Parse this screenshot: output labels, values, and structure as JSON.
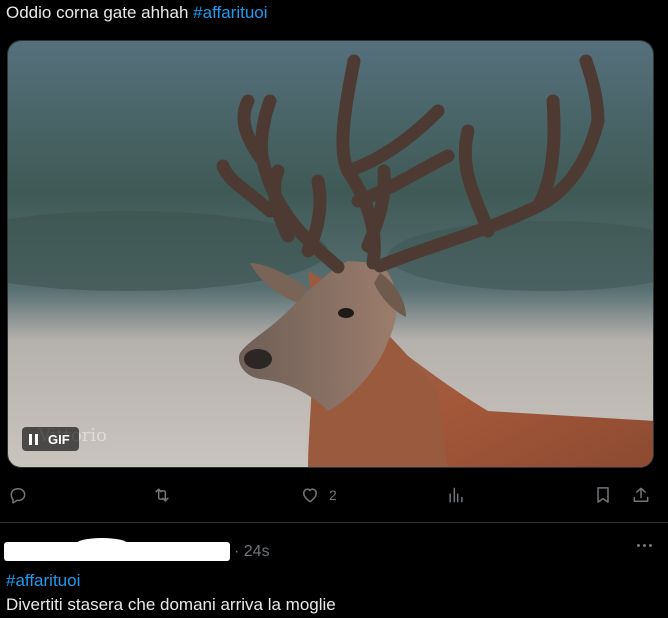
{
  "post": {
    "text": "Oddio corna gate ahhah ",
    "hashtag": "#affarituoi",
    "media_badge": "GIF",
    "media_watermark": "Vittorio"
  },
  "actions": {
    "reply_icon": "reply-icon",
    "repost_icon": "repost-icon",
    "like_icon": "heart-icon",
    "like_count": "2",
    "views_icon": "views-icon",
    "bookmark_icon": "bookmark-icon",
    "share_icon": "share-icon"
  },
  "reply": {
    "timestamp": "· 24s",
    "hashtag": "#affarituoi",
    "text": "Divertiti stasera che domani arriva la moglie"
  },
  "colors": {
    "accent": "#1d9bf0",
    "text": "#e7e9ea",
    "muted": "#71767b",
    "background": "#000000",
    "border": "#2f3336"
  }
}
